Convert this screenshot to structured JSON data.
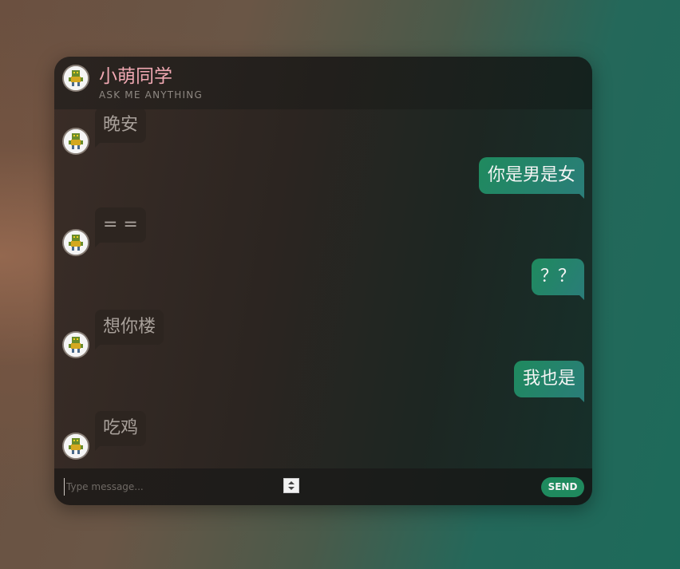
{
  "header": {
    "title": "小萌同学",
    "subtitle": "ASK ME ANYTHING",
    "avatar_icon": "robot-avatar-icon"
  },
  "messages": [
    {
      "sender": "bot",
      "text": "晚安"
    },
    {
      "sender": "user",
      "text": "你是男是女"
    },
    {
      "sender": "bot",
      "text": "= ="
    },
    {
      "sender": "user",
      "text": "？？"
    },
    {
      "sender": "bot",
      "text": "想你楼"
    },
    {
      "sender": "user",
      "text": "我也是"
    },
    {
      "sender": "bot",
      "text": "吃鸡"
    }
  ],
  "composer": {
    "placeholder": "Type message...",
    "send_label": "SEND"
  },
  "colors": {
    "title": "#f0a8b2",
    "user_bubble": "#1f8a5e",
    "bot_bubble": "#2d2520",
    "send_button": "#1f8a5e"
  }
}
